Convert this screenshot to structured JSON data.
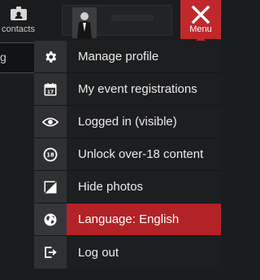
{
  "header": {
    "contacts_label": "contacts",
    "menu_label": "Menu"
  },
  "left_strip": {
    "text": "g"
  },
  "dropdown": {
    "items": [
      {
        "label": "Manage profile",
        "icon": "gear-icon",
        "active": false
      },
      {
        "label": "My event registrations",
        "icon": "calendar-icon",
        "active": false
      },
      {
        "label": "Logged in (visible)",
        "icon": "eye-icon",
        "active": false
      },
      {
        "label": "Unlock over-18 content",
        "icon": "age-18-icon",
        "active": false
      },
      {
        "label": "Hide photos",
        "icon": "hide-photo-icon",
        "active": false
      },
      {
        "label": "Language: English",
        "icon": "globe-icon",
        "active": true
      },
      {
        "label": "Log out",
        "icon": "logout-icon",
        "active": false
      }
    ]
  },
  "colors": {
    "accent": "#c0282c",
    "menu_bg": "#1d1e20",
    "icon_col_bg": "#2f3032",
    "text": "#ececec"
  }
}
